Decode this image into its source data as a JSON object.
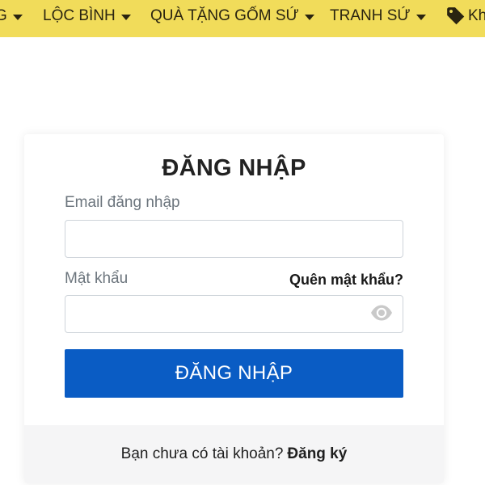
{
  "nav": {
    "items": [
      {
        "label": "G"
      },
      {
        "label": "LỘC BÌNH"
      },
      {
        "label": "QUÀ TẶNG GỐM SỨ"
      },
      {
        "label": "TRANH SỨ"
      },
      {
        "label": "Kh"
      }
    ]
  },
  "login": {
    "title": "ĐĂNG NHẬP",
    "email_label": "Email đăng nhập",
    "email_value": "",
    "password_label": "Mật khẩu",
    "password_value": "",
    "forgot_label": "Quên mật khẩu?",
    "submit_label": "ĐĂNG NHẬP",
    "footer_text": "Bạn chưa có tài khoản?",
    "register_label": "Đăng ký"
  },
  "colors": {
    "nav_bg": "#f1dc5a",
    "button_bg": "#0a5cc4",
    "footer_bg": "#f5f5f6"
  },
  "icons": {
    "tag": "tag-icon",
    "eye": "eye-icon",
    "caret": "caret-down-icon"
  }
}
